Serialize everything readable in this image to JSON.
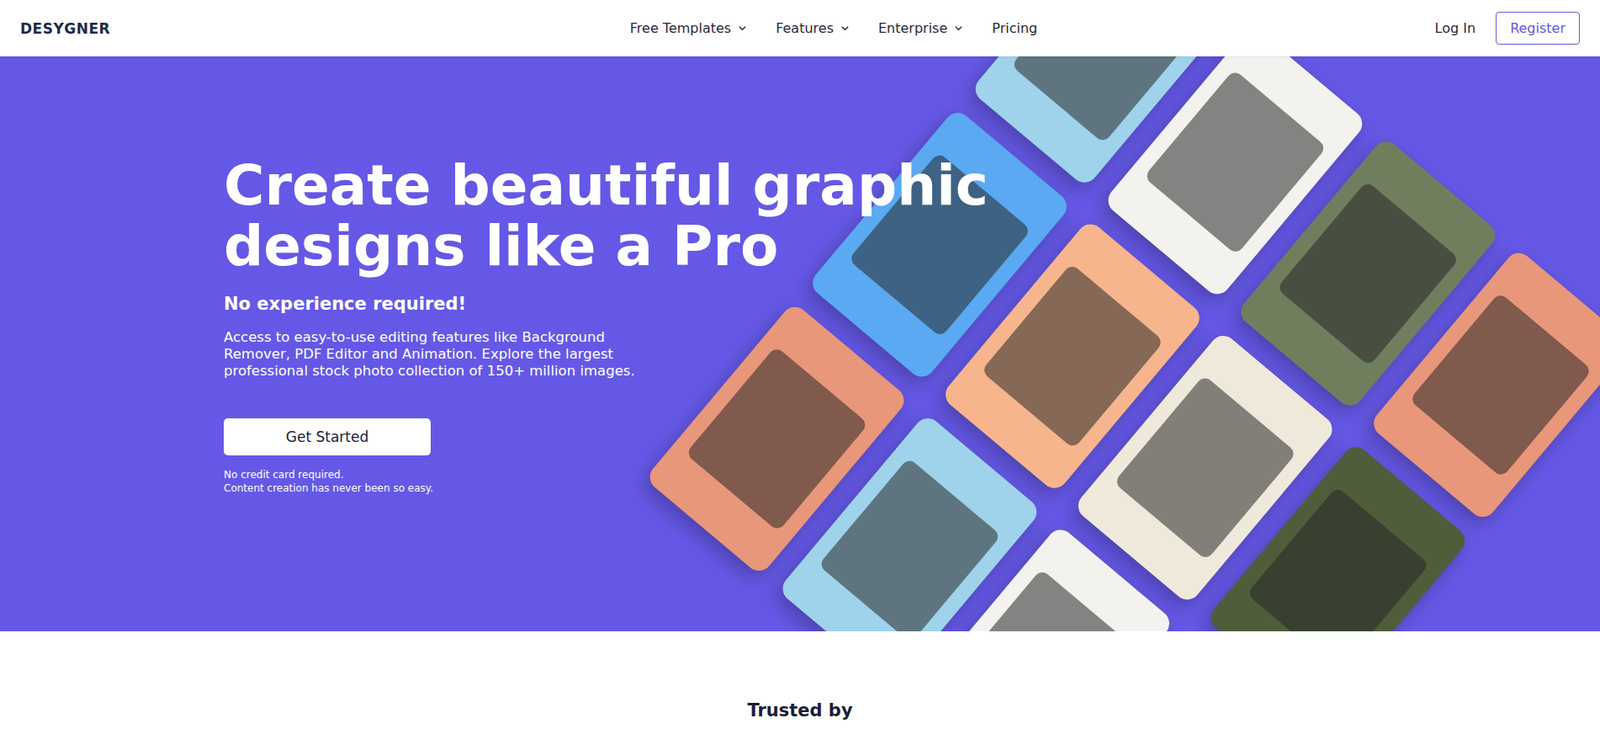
{
  "logo": "DESYGNER",
  "nav": {
    "items": [
      {
        "label": "Free Templates",
        "dropdown": true
      },
      {
        "label": "Features",
        "dropdown": true
      },
      {
        "label": "Enterprise",
        "dropdown": true
      },
      {
        "label": "Pricing",
        "dropdown": false
      }
    ],
    "login": "Log In",
    "register": "Register"
  },
  "hero": {
    "title_lines": [
      "Create beautiful graphic",
      "designs like a Pro"
    ],
    "subtitle": "No experience required!",
    "description": "Access to easy-to-use editing features like Background Remover, PDF Editor and Animation. Explore the largest professional stock photo collection of 150+ million images.",
    "cta": "Get Started",
    "notes": [
      "No credit card required.",
      "Content creation has never been so easy."
    ],
    "cards": [
      {
        "color": "#9fd3ec"
      },
      {
        "color": "#f3f2ef"
      },
      {
        "color": "#6f7f5e"
      },
      {
        "color": "#e9977a"
      },
      {
        "color": "#5aa9f2"
      },
      {
        "color": "#f6b58d"
      },
      {
        "color": "#efe9dc"
      },
      {
        "color": "#4e5e3a"
      },
      {
        "color": "#e9977a"
      },
      {
        "color": "#9fd3ec"
      },
      {
        "color": "#f3f2ef"
      },
      {
        "color": "#6f7f5e"
      }
    ]
  },
  "trusted": {
    "title": "Trusted by"
  }
}
